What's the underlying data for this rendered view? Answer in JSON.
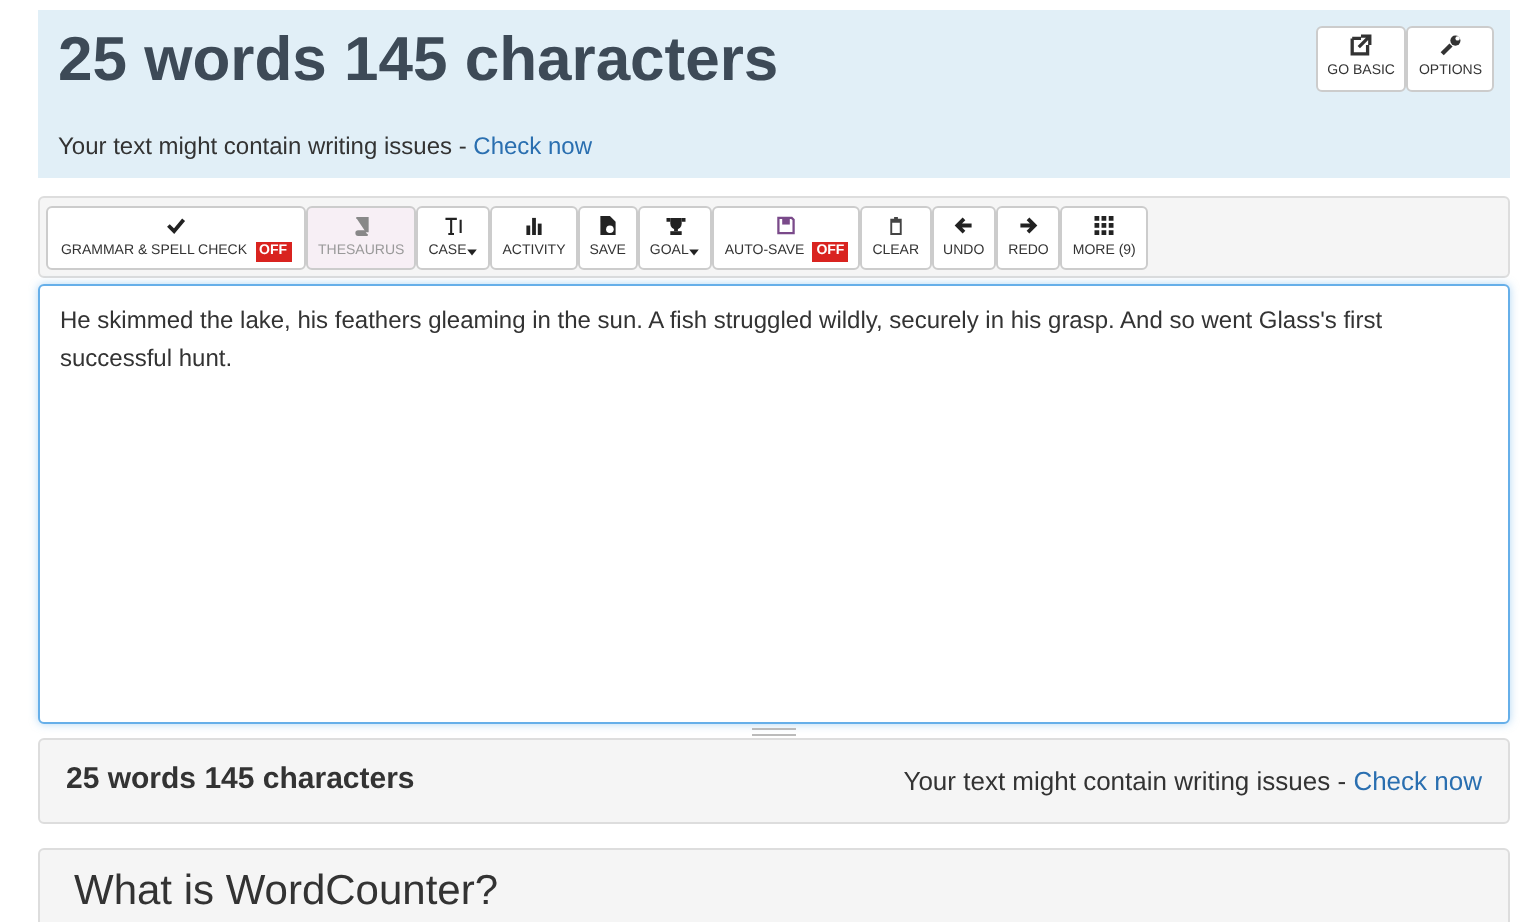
{
  "header": {
    "title": "25 words 145 characters",
    "notice": "Your text might contain writing issues - ",
    "notice_link": "Check now",
    "buttons": [
      {
        "label": "GO BASIC"
      },
      {
        "label": "OPTIONS"
      }
    ]
  },
  "toolbar": [
    {
      "label": "GRAMMAR & SPELL CHECK",
      "badge": "OFF",
      "disabled": false,
      "dropdown": false
    },
    {
      "label": "THESAURUS",
      "disabled": true,
      "dropdown": false
    },
    {
      "label": "CASE",
      "disabled": false,
      "dropdown": true
    },
    {
      "label": "ACTIVITY",
      "disabled": false,
      "dropdown": false
    },
    {
      "label": "SAVE",
      "disabled": false,
      "dropdown": false
    },
    {
      "label": "GOAL",
      "disabled": false,
      "dropdown": true
    },
    {
      "label": "AUTO-SAVE",
      "badge": "OFF",
      "disabled": false,
      "dropdown": false
    },
    {
      "label": "CLEAR",
      "disabled": false,
      "dropdown": false
    },
    {
      "label": "UNDO",
      "disabled": false,
      "dropdown": false
    },
    {
      "label": "REDO",
      "disabled": false,
      "dropdown": false
    },
    {
      "label": "MORE (9)",
      "disabled": false,
      "dropdown": false
    }
  ],
  "editor": {
    "value": "He skimmed the lake, his feathers gleaming in the sun. A fish struggled wildly, securely in his grasp. And so went Glass's first successful hunt."
  },
  "footer": {
    "count": "25 words 145 characters",
    "notice": "Your text might contain writing issues - ",
    "notice_link": "Check now"
  },
  "section": {
    "heading": "What is WordCounter?"
  }
}
